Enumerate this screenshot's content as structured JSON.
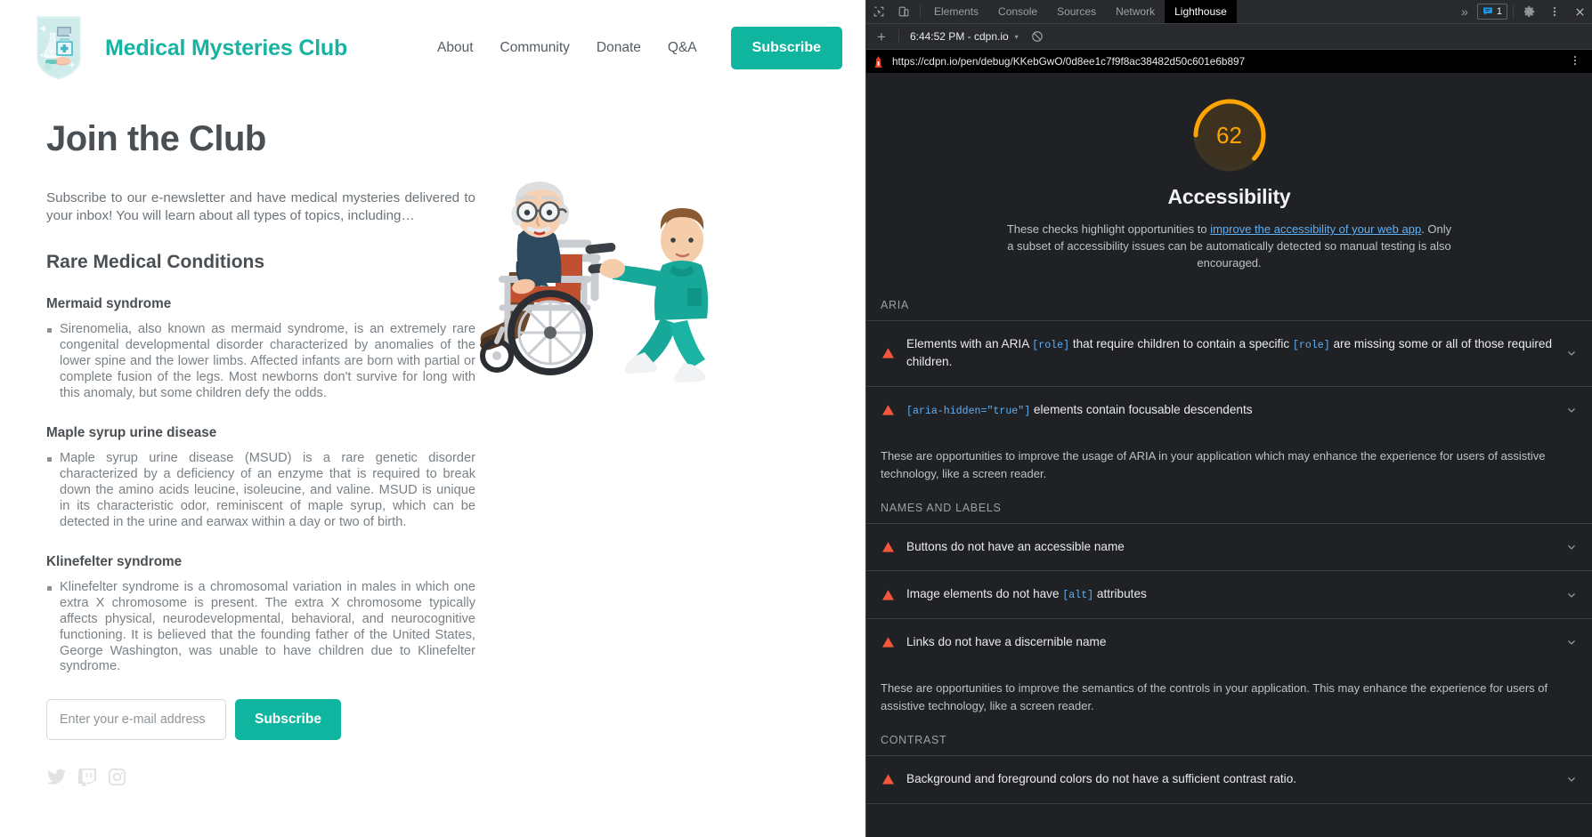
{
  "site": {
    "brand": "Medical Mysteries Club",
    "logo_icon": "medical-shield-logo",
    "nav": [
      {
        "label": "About"
      },
      {
        "label": "Community"
      },
      {
        "label": "Donate"
      }
    ],
    "nav_qa": "Q&A",
    "cta": "Subscribe",
    "accent": "#10b5a0",
    "hero_title": "Join the Club",
    "intro": "Subscribe to our e-newsletter and have medical mysteries delivered to your inbox! You will learn about all types of topics, including…",
    "section_title": "Rare Medical Conditions",
    "conditions": [
      {
        "name": "Mermaid syndrome",
        "body": "Sirenomelia, also known as mermaid syndrome, is an extremely rare congenital developmental disorder characterized by anomalies of the lower spine and the lower limbs. Affected infants are born with partial or complete fusion of the legs. Most newborns don't survive for long with this anomaly, but some children defy the odds."
      },
      {
        "name": "Maple syrup urine disease",
        "body": "Maple syrup urine disease (MSUD) is a rare genetic disorder characterized by a deficiency of an enzyme that is required to break down the amino acids leucine, isoleucine, and valine. MSUD is unique in its characteristic odor, reminiscent of maple syrup, which can be detected in the urine and earwax within a day or two of birth."
      },
      {
        "name": "Klinefelter syndrome",
        "body": "Klinefelter syndrome is a chromosomal variation in males in which one extra X chromosome is present. The extra X chromosome typically affects physical, neurodevelopmental, behavioral, and neurocognitive functioning. It is believed that the founding father of the United States, George Washington, was unable to have children due to Klinefelter syndrome."
      }
    ],
    "form": {
      "email_placeholder": "Enter your e-mail address",
      "email_value": "",
      "submit_label": "Subscribe"
    },
    "socials": [
      {
        "name": "twitter-icon"
      },
      {
        "name": "twitch-icon"
      },
      {
        "name": "instagram-icon"
      }
    ],
    "illustration_alt": "nurse-pushing-elderly-man-in-wheelchair"
  },
  "devtools": {
    "inspect_icon": "inspect-element-icon",
    "device_icon": "device-toolbar-icon",
    "tabs": [
      {
        "label": "Elements",
        "active": false
      },
      {
        "label": "Console",
        "active": false
      },
      {
        "label": "Sources",
        "active": false
      },
      {
        "label": "Network",
        "active": false
      },
      {
        "label": "Lighthouse",
        "active": true
      }
    ],
    "overflow_label": "»",
    "issues_count": "1",
    "issues_icon": "issues-message-icon",
    "settings_icon": "gear-icon",
    "kebab_icon": "more-options-icon",
    "close_icon": "close-icon",
    "subbar": {
      "add_label": "+",
      "run_label": "6:44:52 PM - cdpn.io",
      "caret": "▾",
      "clear_icon": "clear-report-icon"
    },
    "url": "https://cdpn.io/pen/debug/KKebGwO/0d8ee1c7f9f8ac38482d50c601e6b897",
    "url_kebab_icon": "more-options-icon",
    "lighthouse_favicon": "lighthouse-icon"
  },
  "report": {
    "score": "62",
    "score_value": 62,
    "score_color": "#ffa400",
    "category": "Accessibility",
    "description_pre": "These checks highlight opportunities to ",
    "description_link": "improve the accessibility of your web app",
    "description_post": ". Only a subset of accessibility issues can be automatically detected so manual testing is also encouraged.",
    "groups": [
      {
        "title": "ARIA",
        "audits": [
          {
            "icon": "fail-warning-icon",
            "parts": [
              {
                "t": "Elements with an ARIA ",
                "code": false
              },
              {
                "t": "[role]",
                "code": true
              },
              {
                "t": " that require children to contain a specific ",
                "code": false
              },
              {
                "t": "[role]",
                "code": true
              },
              {
                "t": " are missing some or all of those required children.",
                "code": false
              }
            ]
          },
          {
            "icon": "fail-warning-icon",
            "parts": [
              {
                "t": "[aria-hidden=\"true\"]",
                "code": true
              },
              {
                "t": " elements contain focusable descendents",
                "code": false
              }
            ]
          }
        ],
        "note": "These are opportunities to improve the usage of ARIA in your application which may enhance the experience for users of assistive technology, like a screen reader."
      },
      {
        "title": "NAMES AND LABELS",
        "audits": [
          {
            "icon": "fail-warning-icon",
            "parts": [
              {
                "t": "Buttons do not have an accessible name",
                "code": false
              }
            ]
          },
          {
            "icon": "fail-warning-icon",
            "parts": [
              {
                "t": "Image elements do not have ",
                "code": false
              },
              {
                "t": "[alt]",
                "code": true
              },
              {
                "t": " attributes",
                "code": false
              }
            ]
          },
          {
            "icon": "fail-warning-icon",
            "parts": [
              {
                "t": "Links do not have a discernible name",
                "code": false
              }
            ]
          }
        ],
        "note": "These are opportunities to improve the semantics of the controls in your application. This may enhance the experience for users of assistive technology, like a screen reader."
      },
      {
        "title": "CONTRAST",
        "audits": [
          {
            "icon": "fail-warning-icon",
            "parts": [
              {
                "t": "Background and foreground colors do not have a sufficient contrast ratio.",
                "code": false
              }
            ]
          }
        ],
        "note": ""
      }
    ]
  }
}
